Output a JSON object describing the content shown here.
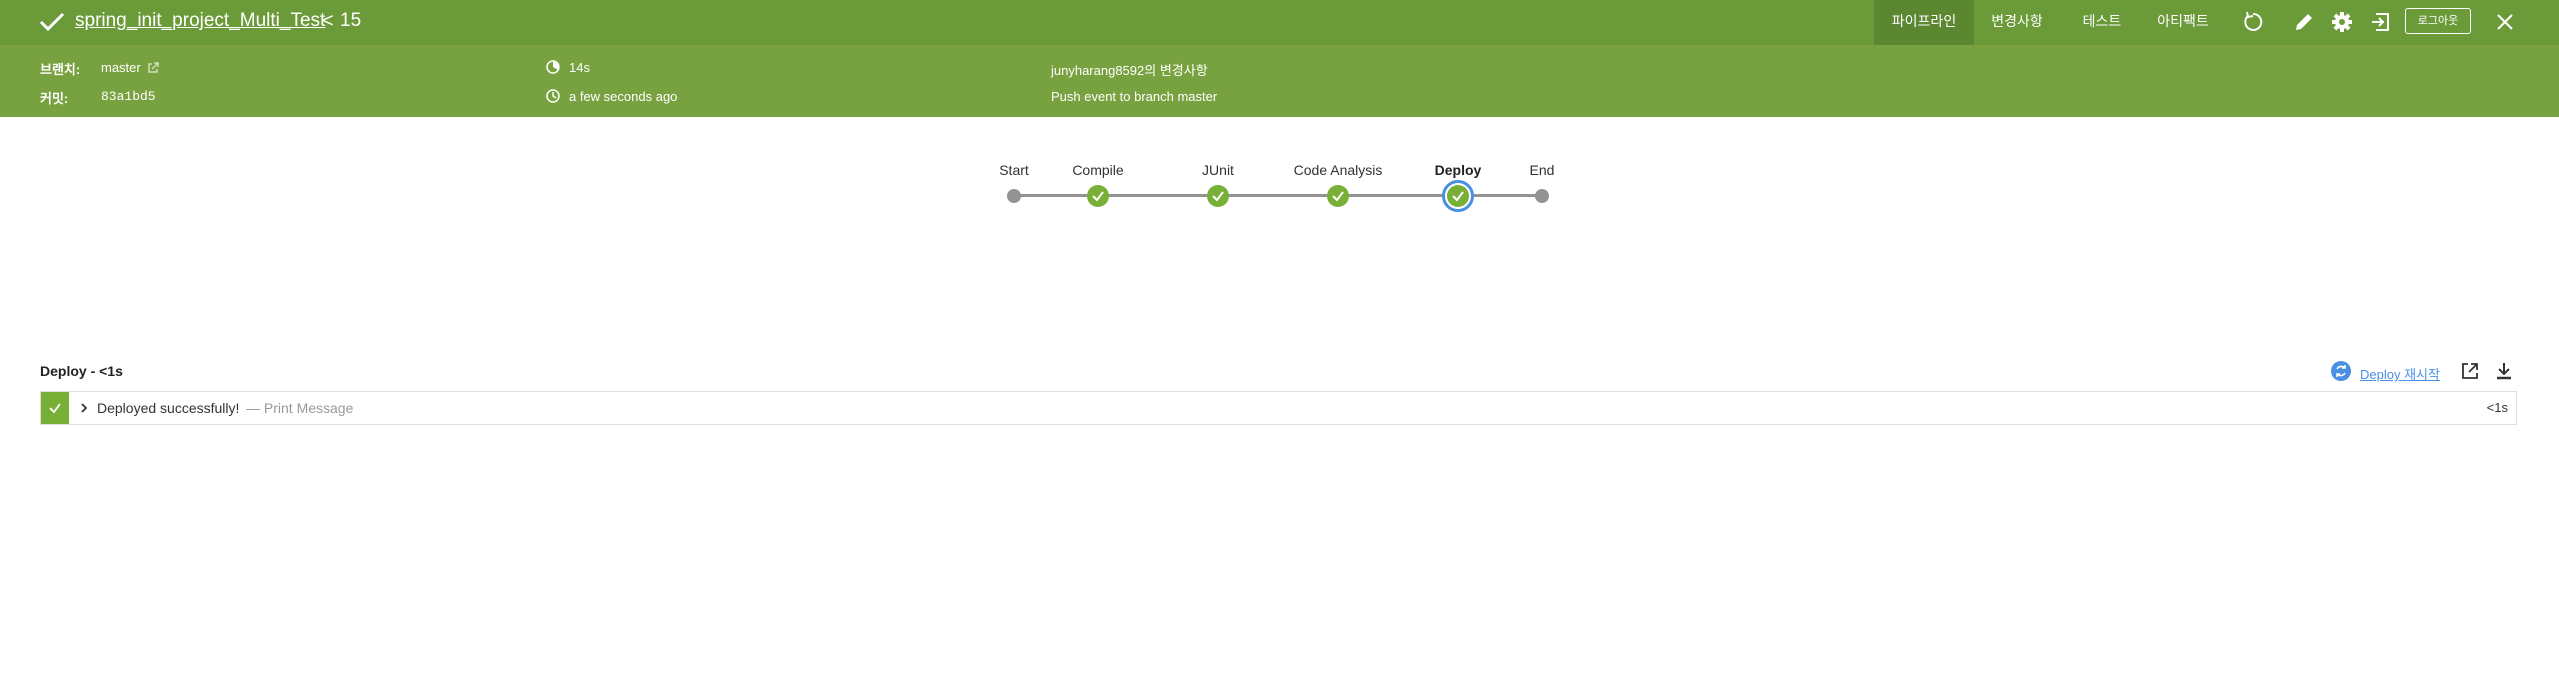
{
  "header": {
    "title": "spring_init_project_Multi_Test",
    "separator": "<",
    "run_number": "15",
    "tabs": [
      {
        "label": "파이프라인",
        "active": true
      },
      {
        "label": "변경사항",
        "active": false
      },
      {
        "label": "테스트",
        "active": false
      },
      {
        "label": "아티팩트",
        "active": false
      }
    ],
    "icons": [
      "replay-icon",
      "edit-icon",
      "settings-icon",
      "exit-icon",
      "close-icon"
    ],
    "logout_label": "로그아웃",
    "colors": {
      "bar": "#6b9a39",
      "active_tab": "#5a8730"
    }
  },
  "run_info": {
    "branch_label": "브랜치:",
    "branch_value": "master",
    "commit_label": "커밋:",
    "commit_value": "83a1bd5",
    "duration": "14s",
    "started": "a few seconds ago",
    "changes_by": "junyharang8592의 변경사항",
    "cause": "Push event to branch master",
    "color": "#78a23f"
  },
  "pipeline": {
    "stages": [
      {
        "name": "Start",
        "kind": "endpoint"
      },
      {
        "name": "Compile",
        "status": "success"
      },
      {
        "name": "JUnit",
        "status": "success"
      },
      {
        "name": "Code Analysis",
        "status": "success"
      },
      {
        "name": "Deploy",
        "status": "success",
        "selected": true
      },
      {
        "name": "End",
        "kind": "endpoint"
      }
    ],
    "success_color": "#78b037",
    "selected_color": "#4a90e2"
  },
  "log": {
    "title": "Deploy - <1s",
    "restart_label": "Deploy 재시작",
    "steps": [
      {
        "message": "Deployed successfully!",
        "description": "— Print Message",
        "duration": "<1s",
        "status": "success"
      }
    ]
  }
}
